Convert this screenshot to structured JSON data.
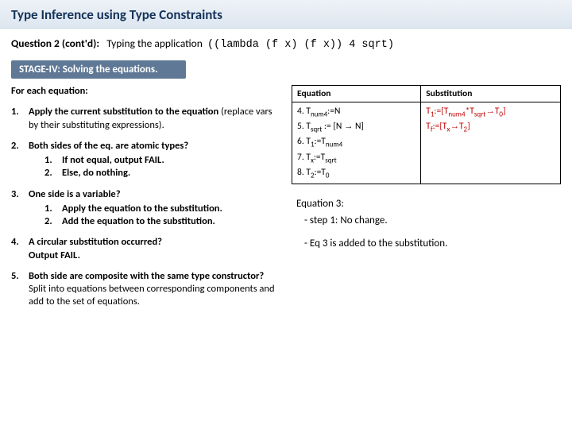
{
  "title": "Type Inference using Type Constraints",
  "question": {
    "label": "Question 2 (cont'd):",
    "lead": "Typing the application",
    "code": "((lambda (f x)  (f x)) 4 sqrt)"
  },
  "stage": "STAGE-IV: Solving the equations.",
  "foreach": "For each equation:",
  "steps": [
    {
      "n": "1.",
      "head_html": "Apply the current substitution to the equation <span style='font-weight:400'>(replace vars by their substituting expressions).</span>"
    },
    {
      "n": "2.",
      "head": "Both sides of the eq. are atomic types?",
      "sub": [
        {
          "n": "1.",
          "t": "If not equal, output FAIL."
        },
        {
          "n": "2.",
          "t": "Else, do nothing."
        }
      ]
    },
    {
      "n": "3.",
      "head": "One side is a variable?",
      "sub": [
        {
          "n": "1.",
          "t": "Apply the equation to the substitution."
        },
        {
          "n": "2.",
          "t": "Add the equation to the substitution."
        }
      ]
    },
    {
      "n": "4.",
      "head_html": "A circular substitution occurred?<br><span style='font-weight:700'>Output FAIL.</span>"
    },
    {
      "n": "5.",
      "head_html": "Both side are composite with the same type constructor?<br><span style='font-weight:400'>Split into equations between corresponding components and add to the set of equations.</span>"
    }
  ],
  "table": {
    "headers": [
      "Equation",
      "Substitution"
    ],
    "eq_lines_html": [
      "4. T<sub>num4</sub>:=N",
      "5. T<sub>sqrt</sub> := [N → N]",
      "6. T<sub>1</sub>:=T<sub>num4</sub>",
      "7. T<sub>x</sub>:=T<sub>sqrt</sub>",
      "8. T<sub>2</sub>:=T<sub>0</sub>"
    ],
    "subst_lines_html": [
      "T<sub>1</sub>:=[T<sub>num4</sub>*T<sub>sqrt</sub>→T<sub>0</sub>]",
      "T<sub>f</sub>:=[T<sub>x</sub>→T<sub>2</sub>]"
    ]
  },
  "notes": {
    "heading": "Equation 3:",
    "items": [
      "step 1: No change.",
      "Eq 3 is added to the substitution."
    ]
  }
}
